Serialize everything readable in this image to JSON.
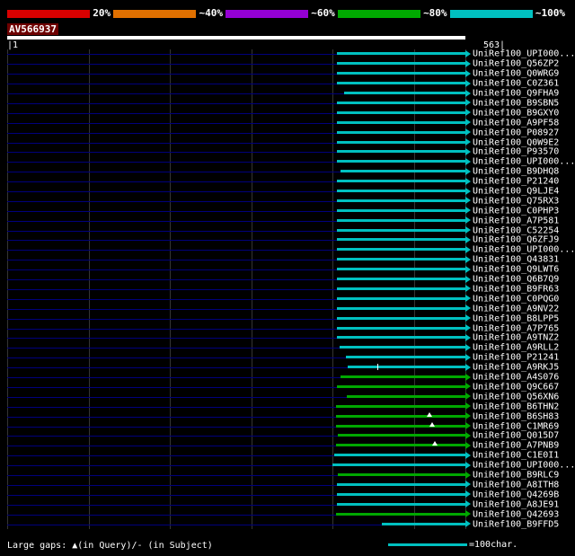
{
  "scale_bar": {
    "segments": [
      {
        "color": "#d80000",
        "label": "20%"
      },
      {
        "color": "#e07000",
        "label": "~40%"
      },
      {
        "color": "#9400d3",
        "label": "~60%"
      },
      {
        "color": "#00a800",
        "label": "~80%"
      },
      {
        "color": "#00c0c0",
        "label": "~100%"
      }
    ]
  },
  "query": {
    "name": "AV566937",
    "ruler_start": "|1",
    "ruler_end": "563|"
  },
  "legend": {
    "gaps_text": "Large gaps: ▲(in Query)/- (in Subject)",
    "scale_text": "=100char."
  },
  "chart_data": {
    "type": "bar",
    "orientation": "horizontal",
    "query_length": 563,
    "grid_interval_chars": 100,
    "color_key": {
      "cyan": "#00c0c0",
      "green": "#00a800"
    },
    "hits": [
      {
        "label": "UniRef100_UPI000...",
        "color": "cyan",
        "start": 405,
        "end": 563
      },
      {
        "label": "UniRef100_Q56ZP2",
        "color": "cyan",
        "start": 405,
        "end": 563
      },
      {
        "label": "UniRef100_Q0WRG9",
        "color": "cyan",
        "start": 405,
        "end": 563
      },
      {
        "label": "UniRef100_C0Z361",
        "color": "cyan",
        "start": 405,
        "end": 563
      },
      {
        "label": "UniRef100_Q9FHA9",
        "color": "cyan",
        "start": 414,
        "end": 563
      },
      {
        "label": "UniRef100_B9SBN5",
        "color": "cyan",
        "start": 405,
        "end": 563
      },
      {
        "label": "UniRef100_B9GXY0",
        "color": "cyan",
        "start": 405,
        "end": 563
      },
      {
        "label": "UniRef100_A9PF58",
        "color": "cyan",
        "start": 405,
        "end": 563
      },
      {
        "label": "UniRef100_P08927",
        "color": "cyan",
        "start": 405,
        "end": 563
      },
      {
        "label": "UniRef100_Q0W9E2",
        "color": "cyan",
        "start": 405,
        "end": 563
      },
      {
        "label": "UniRef100_P93570",
        "color": "cyan",
        "start": 405,
        "end": 563
      },
      {
        "label": "UniRef100_UPI000...",
        "color": "cyan",
        "start": 405,
        "end": 563
      },
      {
        "label": "UniRef100_B9DHQ8",
        "color": "cyan",
        "start": 409,
        "end": 563
      },
      {
        "label": "UniRef100_P21240",
        "color": "cyan",
        "start": 405,
        "end": 563
      },
      {
        "label": "UniRef100_Q9LJE4",
        "color": "cyan",
        "start": 405,
        "end": 563
      },
      {
        "label": "UniRef100_Q75RX3",
        "color": "cyan",
        "start": 405,
        "end": 563
      },
      {
        "label": "UniRef100_C0PHP3",
        "color": "cyan",
        "start": 405,
        "end": 563
      },
      {
        "label": "UniRef100_A7P581",
        "color": "cyan",
        "start": 405,
        "end": 563
      },
      {
        "label": "UniRef100_C52254",
        "color": "cyan",
        "start": 405,
        "end": 563
      },
      {
        "label": "UniRef100_Q6ZFJ9",
        "color": "cyan",
        "start": 405,
        "end": 563
      },
      {
        "label": "UniRef100_UPI000...",
        "color": "cyan",
        "start": 405,
        "end": 563
      },
      {
        "label": "UniRef100_Q43831",
        "color": "cyan",
        "start": 405,
        "end": 563
      },
      {
        "label": "UniRef100_Q9LWT6",
        "color": "cyan",
        "start": 405,
        "end": 563
      },
      {
        "label": "UniRef100_Q6B7Q9",
        "color": "cyan",
        "start": 405,
        "end": 563
      },
      {
        "label": "UniRef100_B9FR63",
        "color": "cyan",
        "start": 405,
        "end": 563
      },
      {
        "label": "UniRef100_C0PQG0",
        "color": "cyan",
        "start": 405,
        "end": 563
      },
      {
        "label": "UniRef100_A9NV22",
        "color": "cyan",
        "start": 405,
        "end": 563
      },
      {
        "label": "UniRef100_B8LPP5",
        "color": "cyan",
        "start": 405,
        "end": 563
      },
      {
        "label": "UniRef100_A7P765",
        "color": "cyan",
        "start": 405,
        "end": 563
      },
      {
        "label": "UniRef100_A9TNZ2",
        "color": "cyan",
        "start": 405,
        "end": 563
      },
      {
        "label": "UniRef100_A9RLL2",
        "color": "cyan",
        "start": 408,
        "end": 563
      },
      {
        "label": "UniRef100_P21241",
        "color": "cyan",
        "start": 416,
        "end": 563
      },
      {
        "label": "UniRef100_A9RKJ5",
        "color": "cyan",
        "start": 418,
        "end": 563,
        "markers": [
          {
            "type": "tick",
            "pos": 455
          }
        ]
      },
      {
        "label": "UniRef100_A4S076",
        "color": "green",
        "start": 410,
        "end": 563
      },
      {
        "label": "UniRef100_Q9C667",
        "color": "green",
        "start": 405,
        "end": 563
      },
      {
        "label": "UniRef100_Q56XN6",
        "color": "green",
        "start": 417,
        "end": 563
      },
      {
        "label": "UniRef100_B6THN2",
        "color": "green",
        "start": 404,
        "end": 563
      },
      {
        "label": "UniRef100_B6SH83",
        "color": "green",
        "start": 404,
        "end": 563,
        "markers": [
          {
            "type": "triangle",
            "pos": 516
          }
        ]
      },
      {
        "label": "UniRef100_C1MR69",
        "color": "green",
        "start": 404,
        "end": 563,
        "markers": [
          {
            "type": "triangle",
            "pos": 519
          }
        ]
      },
      {
        "label": "UniRef100_Q015D7",
        "color": "green",
        "start": 406,
        "end": 563
      },
      {
        "label": "UniRef100_A7PNB9",
        "color": "green",
        "start": 404,
        "end": 563,
        "markers": [
          {
            "type": "triangle",
            "pos": 522
          }
        ]
      },
      {
        "label": "UniRef100_C1E0I1",
        "color": "cyan",
        "start": 402,
        "end": 563
      },
      {
        "label": "UniRef100_UPI000...",
        "color": "cyan",
        "start": 400,
        "end": 563
      },
      {
        "label": "UniRef100_B9RLC9",
        "color": "green",
        "start": 406,
        "end": 563
      },
      {
        "label": "UniRef100_A8ITH8",
        "color": "cyan",
        "start": 405,
        "end": 563
      },
      {
        "label": "UniRef100_Q4269B",
        "color": "cyan",
        "start": 405,
        "end": 563
      },
      {
        "label": "UniRef100_A8JE91",
        "color": "cyan",
        "start": 405,
        "end": 563
      },
      {
        "label": "UniRef100_Q42693",
        "color": "green",
        "start": 404,
        "end": 563
      },
      {
        "label": "UniRef100_B9FFD5",
        "color": "cyan",
        "start": 460,
        "end": 563
      }
    ]
  }
}
